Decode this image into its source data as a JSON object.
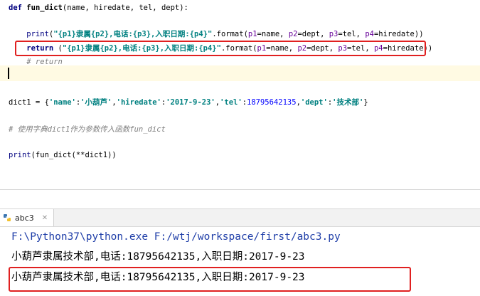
{
  "editor": {
    "lines": [
      {
        "id": "def",
        "tokens": [
          {
            "t": "def ",
            "c": "kw"
          },
          {
            "t": "fun_dict",
            "c": "fn"
          },
          {
            "t": "(name, hiredate, tel, dept):",
            "c": ""
          }
        ]
      },
      {
        "id": "print",
        "tokens": [
          {
            "t": "    print",
            "c": "builtin"
          },
          {
            "t": "(",
            "c": ""
          },
          {
            "t": "\"{p1}隶属{p2},电话:{p3},入职日期:{p4}\"",
            "c": "str"
          },
          {
            "t": ".format(",
            "c": ""
          },
          {
            "t": "p1",
            "c": "pname"
          },
          {
            "t": "=name, ",
            "c": ""
          },
          {
            "t": "p2",
            "c": "pname"
          },
          {
            "t": "=dept, ",
            "c": ""
          },
          {
            "t": "p3",
            "c": "pname"
          },
          {
            "t": "=tel, ",
            "c": ""
          },
          {
            "t": "p4",
            "c": "pname"
          },
          {
            "t": "=hiredate))",
            "c": ""
          }
        ]
      },
      {
        "id": "return",
        "tokens": [
          {
            "t": "    return ",
            "c": "kw"
          },
          {
            "t": "(",
            "c": ""
          },
          {
            "t": "\"{p1}隶属{p2},电话:{p3},入职日期:{p4}\"",
            "c": "str"
          },
          {
            "t": ".format(",
            "c": ""
          },
          {
            "t": "p1",
            "c": "pname"
          },
          {
            "t": "=name, ",
            "c": ""
          },
          {
            "t": "p2",
            "c": "pname"
          },
          {
            "t": "=dept, ",
            "c": ""
          },
          {
            "t": "p3",
            "c": "pname"
          },
          {
            "t": "=tel, ",
            "c": ""
          },
          {
            "t": "p4",
            "c": "pname"
          },
          {
            "t": "=hiredate))",
            "c": ""
          }
        ]
      },
      {
        "id": "comment-return",
        "tokens": [
          {
            "t": "    # return",
            "c": "cmt"
          }
        ]
      },
      {
        "id": "dict",
        "tokens": [
          {
            "t": "dict1 = {",
            "c": ""
          },
          {
            "t": "'name'",
            "c": "key"
          },
          {
            "t": ":",
            "c": ""
          },
          {
            "t": "'小葫芦'",
            "c": "key"
          },
          {
            "t": ",",
            "c": ""
          },
          {
            "t": "'hiredate'",
            "c": "key"
          },
          {
            "t": ":",
            "c": ""
          },
          {
            "t": "'2017-9-23'",
            "c": "key"
          },
          {
            "t": ",",
            "c": ""
          },
          {
            "t": "'tel'",
            "c": "key"
          },
          {
            "t": ":",
            "c": ""
          },
          {
            "t": "18795642135",
            "c": "num"
          },
          {
            "t": ",",
            "c": ""
          },
          {
            "t": "'dept'",
            "c": "key"
          },
          {
            "t": ":",
            "c": ""
          },
          {
            "t": "'技术部'",
            "c": "key"
          },
          {
            "t": "}",
            "c": ""
          }
        ]
      },
      {
        "id": "comment-usage",
        "tokens": [
          {
            "t": "# 使用字典",
            "c": "cmt"
          },
          {
            "t": "dict1",
            "c": "cmt"
          },
          {
            "t": "作为参数传入函数",
            "c": "cmt"
          },
          {
            "t": "fun_dict",
            "c": "cmt"
          }
        ]
      },
      {
        "id": "print-call",
        "tokens": [
          {
            "t": "print",
            "c": "builtin"
          },
          {
            "t": "(fun_dict(**dict1))",
            "c": ""
          }
        ]
      }
    ]
  },
  "run": {
    "tab_label": "abc3",
    "output": [
      {
        "text": "F:\\Python37\\python.exe F:/wtj/workspace/first/abc3.py",
        "color": "#1f3ea8"
      },
      {
        "text": "小葫芦隶属技术部,电话:18795642135,入职日期:2017-9-23",
        "color": "#000000"
      },
      {
        "text": "小葫芦隶属技术部,电话:18795642135,入职日期:2017-9-23",
        "color": "#000000"
      }
    ]
  },
  "colors": {
    "highlight_box": "#e02020",
    "current_line": "#fffae3"
  }
}
